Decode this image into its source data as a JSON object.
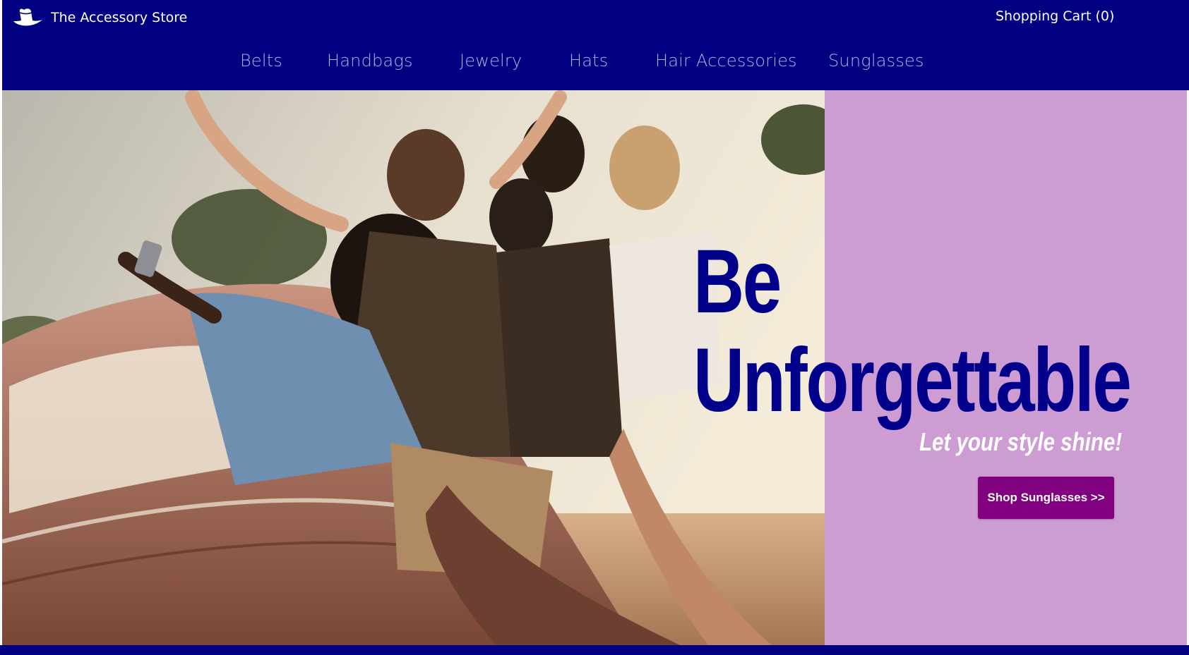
{
  "header": {
    "brand_name": "The Accessory Store",
    "logo_icon": "hat-icon",
    "cart_label": "Shopping Cart (0)"
  },
  "nav": {
    "items": [
      {
        "label": "Belts"
      },
      {
        "label": "Handbags"
      },
      {
        "label": "Jewelry"
      },
      {
        "label": "Hats"
      },
      {
        "label": "Hair Accessories"
      },
      {
        "label": "Sunglasses"
      }
    ]
  },
  "hero": {
    "headline_line1": "Be",
    "headline_line2": "Unforgettable",
    "tagline": "Let your style shine!",
    "cta_label": "Shop Sunglasses >>"
  },
  "colors": {
    "navy": "#000080",
    "nav_link": "#a9b5ea",
    "panel_lilac": "#cc9cd3",
    "headline": "#00008b",
    "cta_purple": "#800080"
  }
}
